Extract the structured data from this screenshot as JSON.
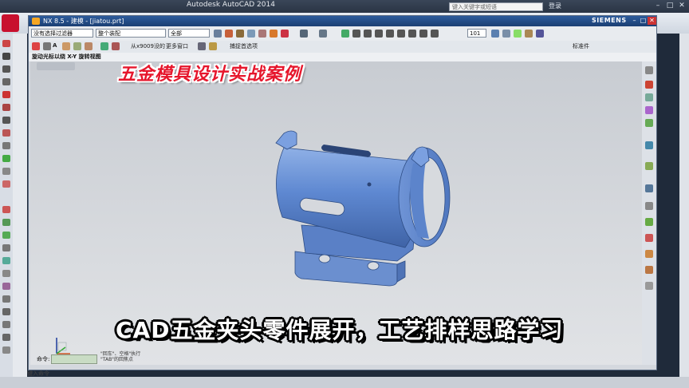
{
  "autocad": {
    "title": "Autodesk AutoCAD 2014",
    "search_placeholder": "键入关键字或短语",
    "login_label": "登录",
    "window_controls": [
      "–",
      "□",
      "✕"
    ],
    "command_prompt": "键入命令"
  },
  "nx": {
    "title": "NX 8.5 - 建模 - [jiatou.prt]",
    "brand": "SIEMENS",
    "window_controls": [
      "–",
      "□",
      "✕"
    ],
    "toolbar": {
      "filter_select": "没有选择过滤器",
      "assembly_select": "整个装配",
      "scope_select": "全部",
      "scale_value": "101"
    },
    "toolbar2": {
      "status_text": "从x9009没的",
      "window_label": "更多窗口",
      "snap_label": "捕捉首选项",
      "reuse_label": "标准件"
    },
    "hint_text": "旋动光标以绕 X-Y 旋转视图",
    "cmd_label": "命令:",
    "cmd_hint": "\"回车\"、空格\"执行 \"TAB\"的回焦点"
  },
  "captions": {
    "top": "五金模具设计实战案例",
    "bottom": "CAD五金夹头零件展开，工艺排样思路学习"
  },
  "colors": {
    "part_blue": "#5d86cc",
    "caption_red": "#e6162c"
  }
}
